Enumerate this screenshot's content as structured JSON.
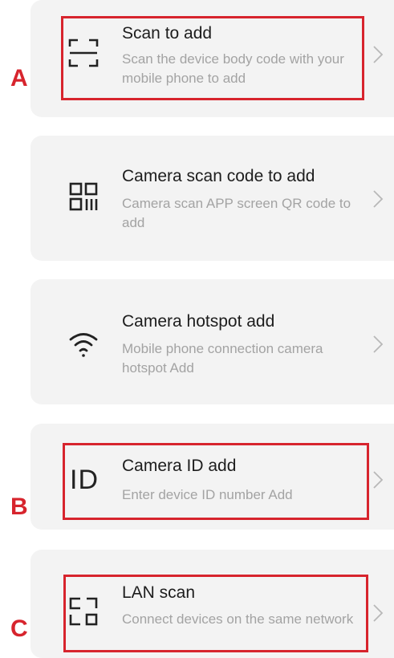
{
  "items": [
    {
      "icon": "scan-frame-icon",
      "title": "Scan to add",
      "description": "Scan the device body code with your mobile phone to add"
    },
    {
      "icon": "qr-code-icon",
      "title": "Camera scan code to add",
      "description": "Camera scan APP screen QR code to add"
    },
    {
      "icon": "wifi-icon",
      "title": "Camera hotspot add",
      "description": "Mobile phone connection camera hotspot Add"
    },
    {
      "icon": "id-text-icon",
      "icon_text": "ID",
      "title": "Camera ID add",
      "description": "Enter device ID number Add"
    },
    {
      "icon": "lan-icon",
      "title": "LAN scan",
      "description": "Connect devices on the same network"
    }
  ],
  "annotations": {
    "a": "A",
    "b": "B",
    "c": "C",
    "highlight_color": "#d7242d"
  },
  "colors": {
    "card_background": "#f3f3f3",
    "title": "#1d1d1d",
    "description": "#a3a3a3",
    "chevron": "#b8b8b8"
  }
}
